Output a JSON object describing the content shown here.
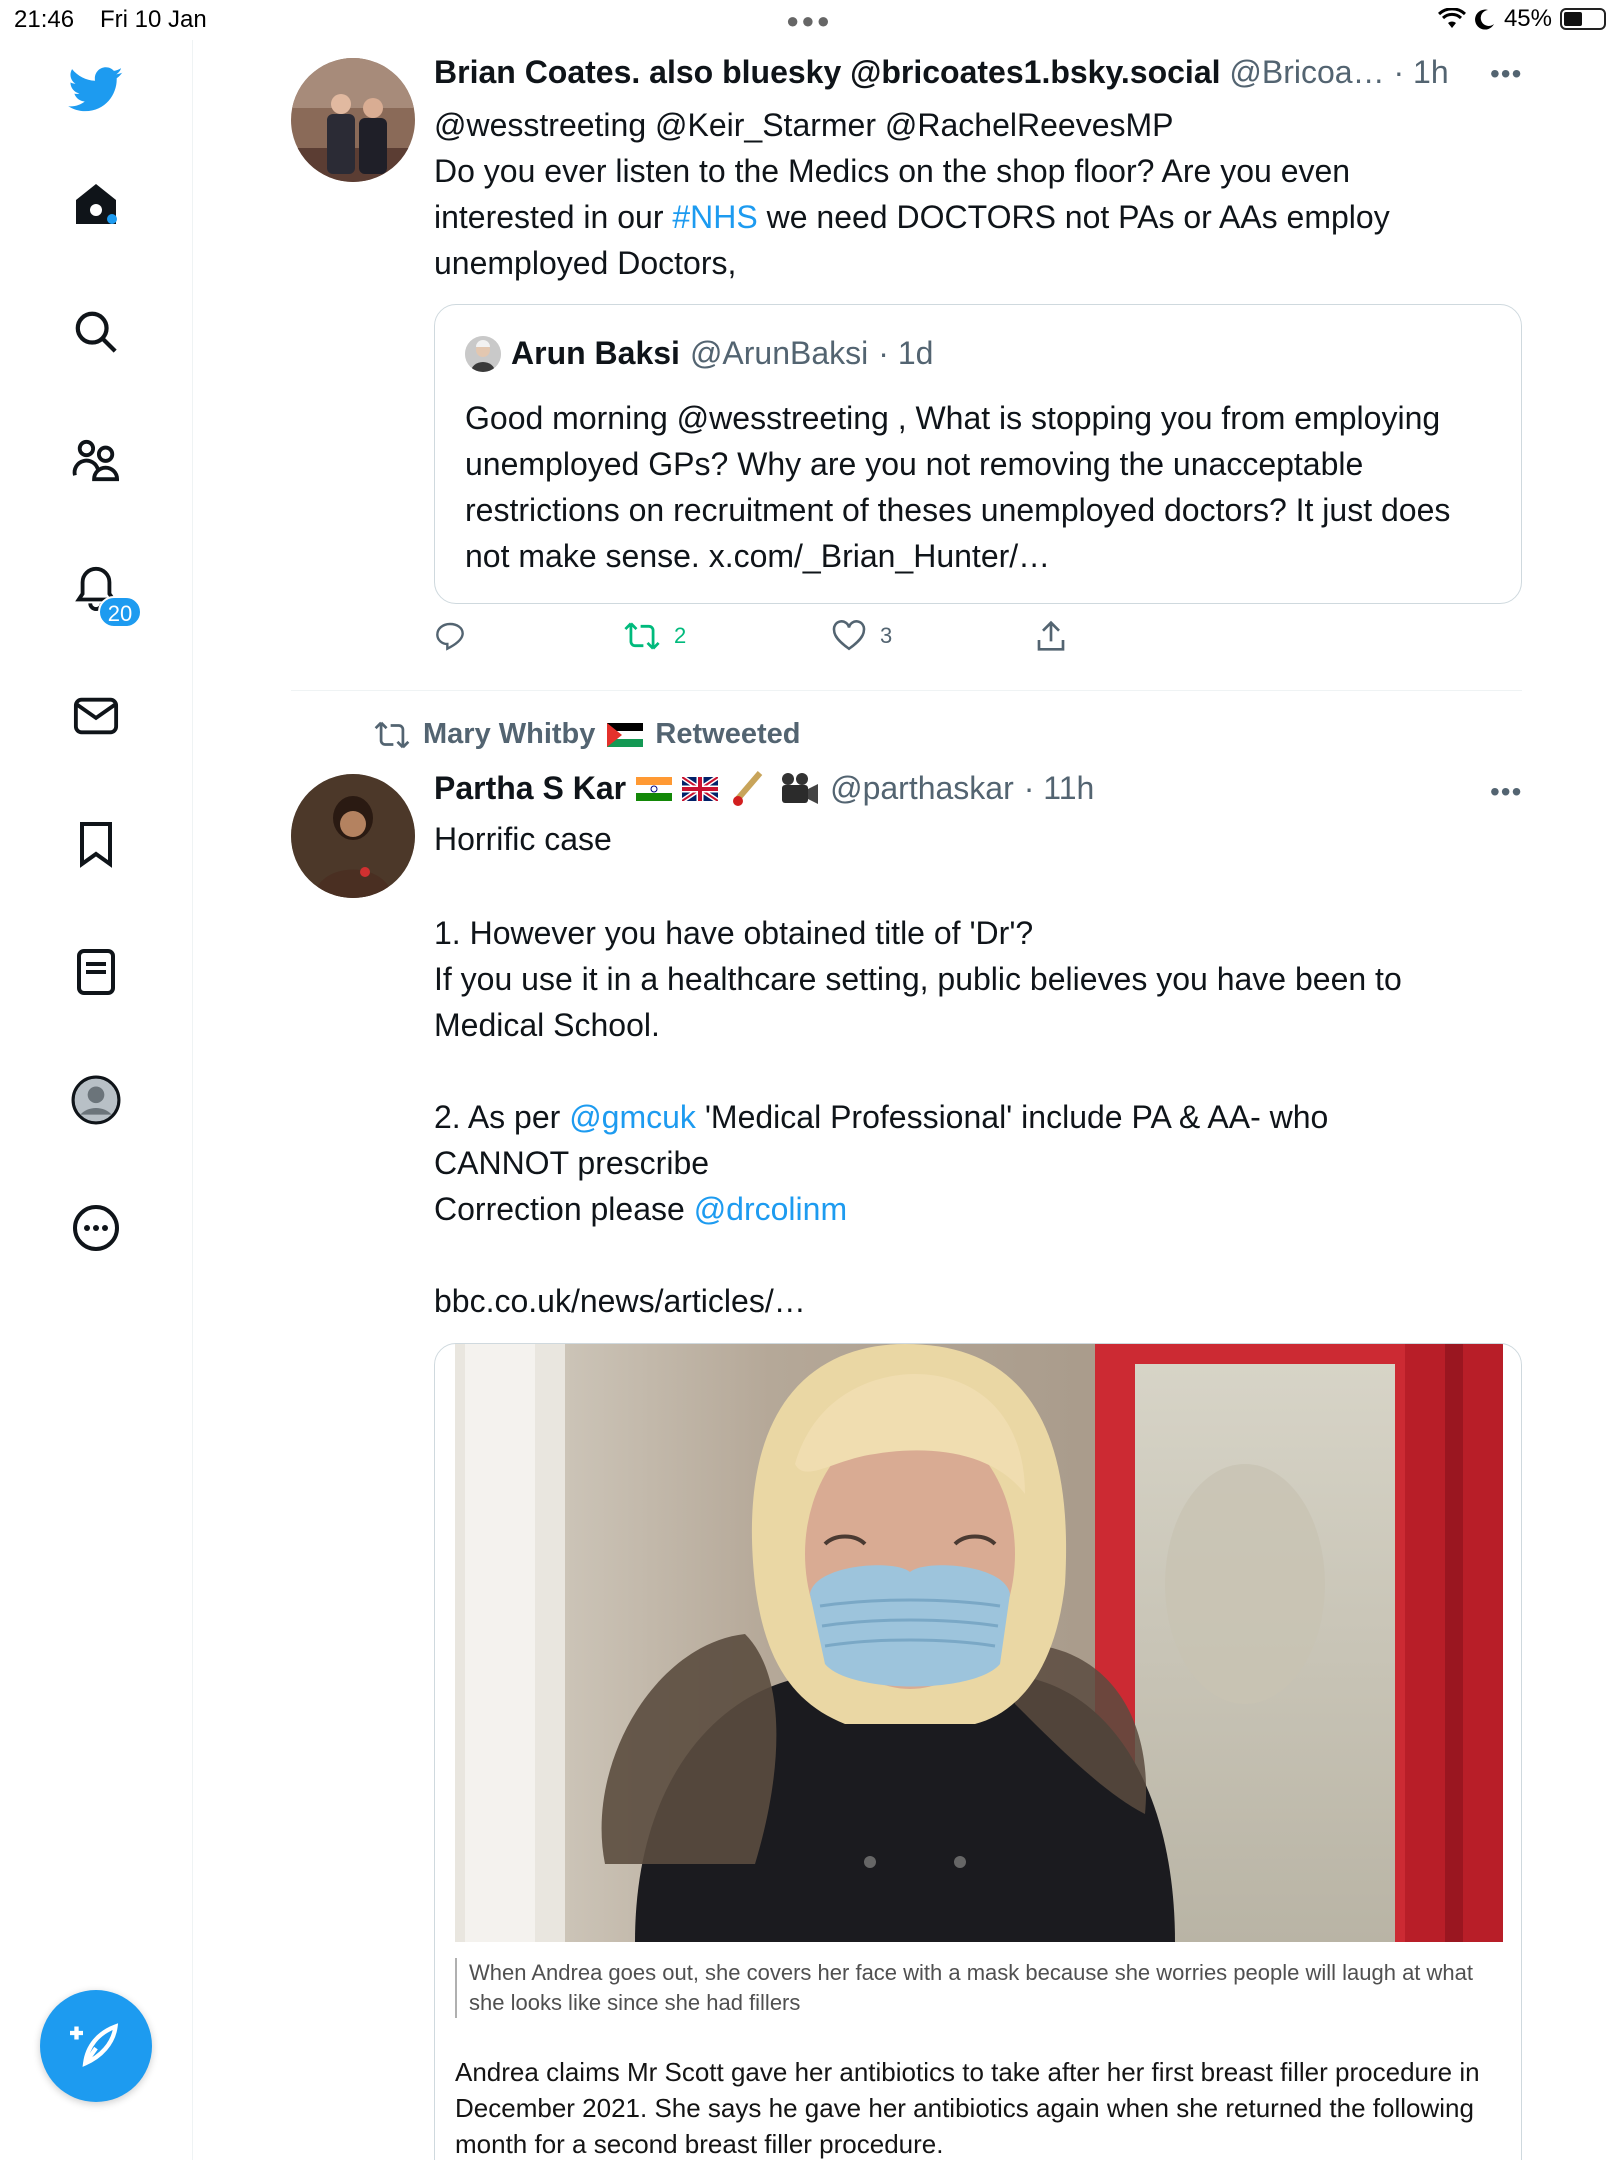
{
  "status_bar": {
    "time": "21:46",
    "date": "Fri 10 Jan",
    "battery": "45%",
    "battery_level": 0.45
  },
  "sidebar": {
    "notifications_badge": "20"
  },
  "tweet1": {
    "name": "Brian Coates. also bluesky @bricoates1.bsky.social",
    "handle": "@Bricoa…",
    "time": "· 1h",
    "mentions": "@wesstreeting @Keir_Starmer @RachelReevesMP",
    "text_a": "Do you ever listen to the Medics on the shop floor? Are you even\ninterested in our ",
    "hashtag": "#NHS",
    "text_b": " we need DOCTORS not PAs or AAs employ\nunemployed Doctors,",
    "quote": {
      "name": "Arun Baksi",
      "handle": "@ArunBaksi",
      "time": "· 1d",
      "text": "Good morning @wesstreeting , What is stopping you from employing unemployed GPs? Why are you not removing the unacceptable restrictions on recruitment of theses unemployed doctors? It just does not make sense. x.com/_Brian_Hunter/…"
    },
    "retweets": "2",
    "likes": "3"
  },
  "tweet2": {
    "retweeted_by": "Mary Whitby",
    "retweeted_label": "Retweeted",
    "name": "Partha S Kar",
    "handle": "@parthaskar",
    "time": "· 11h",
    "line1": "Horrific case",
    "point1": "1. However you have obtained title of 'Dr'?\nIf you use it in a healthcare setting, public believes you have been to\nMedical School.",
    "point2_a": "2. As per ",
    "point2_mention": "@gmcuk",
    "point2_b": " 'Medical Professional' include PA & AA- who\nCANNOT prescribe\nCorrection please ",
    "point2_mention2": "@drcolinm",
    "link": "bbc.co.uk/news/articles/…",
    "caption": "When Andrea goes out, she covers her face with a mask because she worries people will laugh at what she looks like since she had fillers",
    "article": "Andrea claims Mr Scott gave her antibiotics to take after her first breast filler procedure in December 2021. She says he gave her antibiotics again when she returned the following month for a second breast filler procedure."
  },
  "colors": {
    "accent": "#1d9bf0",
    "retweet": "#00ba7c",
    "muted": "#536471"
  }
}
